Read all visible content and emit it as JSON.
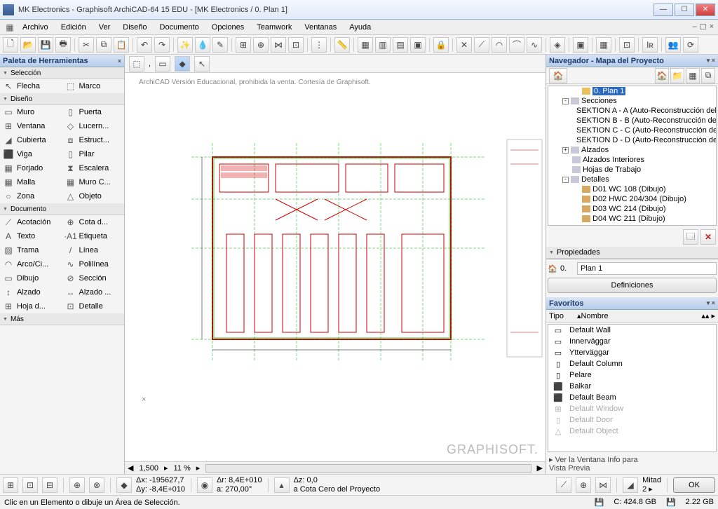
{
  "title": "MK Electronics - Graphisoft ArchiCAD-64 15 EDU - [MK Electronics / 0. Plan 1]",
  "menu": [
    "Archivo",
    "Edición",
    "Ver",
    "Diseño",
    "Documento",
    "Opciones",
    "Teamwork",
    "Ventanas",
    "Ayuda"
  ],
  "palette": {
    "title": "Paleta de Herramientas",
    "groups": [
      {
        "name": "Selección",
        "tools": [
          [
            "↖",
            "Flecha"
          ],
          [
            "⬚",
            "Marco"
          ]
        ]
      },
      {
        "name": "Diseño",
        "tools": [
          [
            "▭",
            "Muro"
          ],
          [
            "▯",
            "Puerta"
          ],
          [
            "⊞",
            "Ventana"
          ],
          [
            "◇",
            "Lucern..."
          ],
          [
            "◢",
            "Cubierta"
          ],
          [
            "⧈",
            "Estruct..."
          ],
          [
            "⬛",
            "Viga"
          ],
          [
            "▯",
            "Pilar"
          ],
          [
            "▦",
            "Forjado"
          ],
          [
            "⧗",
            "Escalera"
          ],
          [
            "▦",
            "Malla"
          ],
          [
            "▦",
            "Muro C..."
          ],
          [
            "○",
            "Zona"
          ],
          [
            "△",
            "Objeto"
          ]
        ]
      },
      {
        "name": "Documento",
        "tools": [
          [
            "⟋",
            "Acotación"
          ],
          [
            "⊕",
            "Cota d..."
          ],
          [
            "A",
            "Texto"
          ],
          [
            "·A1",
            "Etiqueta"
          ],
          [
            "▨",
            "Trama"
          ],
          [
            "/",
            "Línea"
          ],
          [
            "◠",
            "Arco/Ci..."
          ],
          [
            "∿",
            "Polilínea"
          ],
          [
            "▭",
            "Dibujo"
          ],
          [
            "⊘",
            "Sección"
          ],
          [
            "↕",
            "Alzado"
          ],
          [
            "↔",
            "Alzado ..."
          ],
          [
            "⊞",
            "Hoja d..."
          ],
          [
            "⊡",
            "Detalle"
          ]
        ]
      },
      {
        "name": "Más",
        "tools": []
      }
    ]
  },
  "watermark_top": "ArchiCAD Versión Educacional, prohibida la venta. Cortesía de Graphisoft.",
  "watermark_bot": "GRAPHISOFT.",
  "navigator": {
    "title": "Navegador - Mapa del Proyecto",
    "tree": [
      {
        "indent": 2,
        "sel": true,
        "icon": "folder",
        "label": "0. Plan 1"
      },
      {
        "indent": 1,
        "expand": "-",
        "icon": "doc",
        "label": "Secciones"
      },
      {
        "indent": 2,
        "icon": "house",
        "label": "SEKTION A - A (Auto-Reconstrucción del"
      },
      {
        "indent": 2,
        "icon": "house",
        "label": "SEKTION B - B (Auto-Reconstrucción del"
      },
      {
        "indent": 2,
        "icon": "house",
        "label": "SEKTION C - C (Auto-Reconstrucción del"
      },
      {
        "indent": 2,
        "icon": "house",
        "label": "SEKTION D - D (Auto-Reconstrucción del"
      },
      {
        "indent": 1,
        "expand": "+",
        "icon": "doc",
        "label": "Alzados"
      },
      {
        "indent": 1,
        "icon": "doc",
        "label": "Alzados Interiores"
      },
      {
        "indent": 1,
        "icon": "doc",
        "label": "Hojas de Trabajo"
      },
      {
        "indent": 1,
        "expand": "-",
        "icon": "doc",
        "label": "Detalles"
      },
      {
        "indent": 2,
        "icon": "house",
        "label": "D01 WC 108 (Dibujo)"
      },
      {
        "indent": 2,
        "icon": "house",
        "label": "D02 HWC 204/304 (Dibujo)"
      },
      {
        "indent": 2,
        "icon": "house",
        "label": "D03 WC 214 (Dibujo)"
      },
      {
        "indent": 2,
        "icon": "house",
        "label": "D04 WC 211 (Dibujo)"
      }
    ]
  },
  "props": {
    "title": "Propiedades",
    "id": "0.",
    "name": "Plan 1",
    "btn": "Definiciones"
  },
  "favorites": {
    "title": "Favoritos",
    "col1": "Tipo",
    "col2": "Nombre",
    "items": [
      {
        "icon": "▭",
        "label": "Default Wall"
      },
      {
        "icon": "▭",
        "label": "Innerväggar"
      },
      {
        "icon": "▭",
        "label": "Ytterväggar"
      },
      {
        "icon": "▯",
        "label": "Default Column"
      },
      {
        "icon": "▯",
        "label": "Pelare"
      },
      {
        "icon": "⬛",
        "label": "Balkar"
      },
      {
        "icon": "⬛",
        "label": "Default Beam"
      },
      {
        "icon": "⊞",
        "label": "Default Window",
        "gray": true
      },
      {
        "icon": "▯",
        "label": "Default Door",
        "gray": true
      },
      {
        "icon": "△",
        "label": "Default Object",
        "gray": true
      }
    ],
    "info": "Ver la Ventana Info para\nVista Previa"
  },
  "scrollbar": {
    "left": "1,500",
    "right": "11 %"
  },
  "coords": {
    "dx": "Δx: -195627,7",
    "dy": "Δy: -8,4E+010",
    "dr": "Δr: 8,4E+010",
    "da": "a: 270,00°",
    "dz": "Δz: 0,0",
    "level": "a Cota Cero del Proyecto",
    "mitad": "Mitad",
    "mitad_val": "2",
    "ok": "OK"
  },
  "status": {
    "left": "Clic en un Elemento o dibuje un Área de Selección.",
    "c": "C: 424.8 GB",
    "d": "2.22 GB"
  }
}
